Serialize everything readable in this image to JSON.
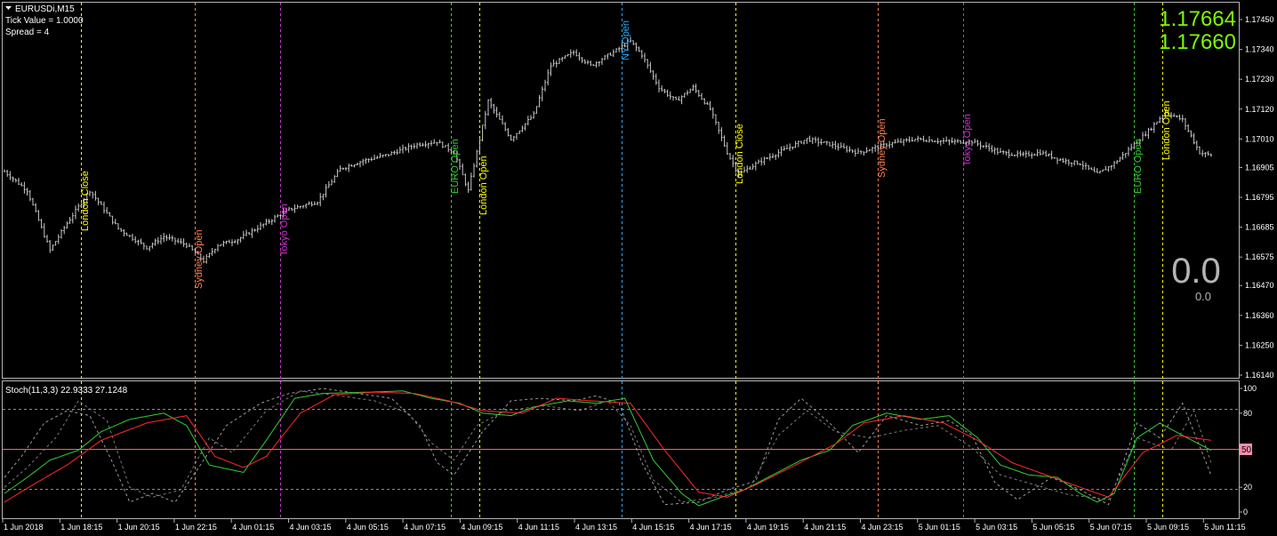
{
  "header": {
    "symbol": "EURUSDi,M15",
    "tick_value": "Tick Value = 1.0000",
    "spread": "Spread = 4"
  },
  "quotes": {
    "ask": "1.17664",
    "bid": "1.17660"
  },
  "counter": {
    "large": "0.0",
    "small": "0.0"
  },
  "colors": {
    "background": "#000000",
    "bars": "#c8c8c8",
    "quotes": "#7CFC00",
    "london": "#ffff00",
    "sydney": "#ff7f50",
    "tokyo": "#cc33cc",
    "euro": "#33cc33",
    "ny": "#2aa8ff",
    "stoch_main": "#32cd32",
    "stoch_signal": "#ff2a2a",
    "level50": "#ff6060"
  },
  "session_lines": [
    {
      "label": "London Close",
      "color": "london"
    },
    {
      "label": "Sydney Open",
      "color": "sydney"
    },
    {
      "label": "Tokyo Open",
      "color": "tokyo"
    },
    {
      "label": "EURO Open",
      "color": "euro"
    },
    {
      "label": "London Open",
      "color": "london"
    },
    {
      "label": "NY Open",
      "color": "ny"
    },
    {
      "label": "London Close",
      "color": "london"
    },
    {
      "label": "Sydney Open",
      "color": "sydney"
    },
    {
      "label": "Tokyo Open",
      "color": "tokyo"
    },
    {
      "label": "EURO Open",
      "color": "euro"
    },
    {
      "label": "London Open",
      "color": "london"
    }
  ],
  "price_axis": [
    "1.17450",
    "1.17340",
    "1.17230",
    "1.17120",
    "1.17010",
    "1.16905",
    "1.16795",
    "1.16685",
    "1.16575",
    "1.16470",
    "1.16360",
    "1.16250",
    "1.16140"
  ],
  "indicator": {
    "title": "Stoch(11,3,3) 22.9333 27.1248",
    "axis": [
      "100",
      "80",
      "20",
      "0"
    ],
    "level_label": "50"
  },
  "time_axis": [
    "1 Jun 2018",
    "1 Jun 18:15",
    "1 Jun 20:15",
    "1 Jun 22:15",
    "4 Jun 01:15",
    "4 Jun 03:15",
    "4 Jun 05:15",
    "4 Jun 07:15",
    "4 Jun 09:15",
    "4 Jun 11:15",
    "4 Jun 13:15",
    "4 Jun 15:15",
    "4 Jun 17:15",
    "4 Jun 19:15",
    "4 Jun 21:15",
    "4 Jun 23:15",
    "5 Jun 01:15",
    "5 Jun 03:15",
    "5 Jun 05:15",
    "5 Jun 07:15",
    "5 Jun 09:15",
    "5 Jun 11:15"
  ],
  "price_anchors": [
    [
      0,
      1.1689
    ],
    [
      8,
      1.1682
    ],
    [
      16,
      1.166
    ],
    [
      22,
      1.167
    ],
    [
      30,
      1.1682
    ],
    [
      40,
      1.1668
    ],
    [
      50,
      1.1661
    ],
    [
      56,
      1.1665
    ],
    [
      64,
      1.1662
    ],
    [
      70,
      1.1656
    ],
    [
      75,
      1.1662
    ],
    [
      82,
      1.1664
    ],
    [
      95,
      1.1672
    ],
    [
      100,
      1.1675
    ],
    [
      110,
      1.1678
    ],
    [
      118,
      1.169
    ],
    [
      126,
      1.1693
    ],
    [
      134,
      1.1695
    ],
    [
      145,
      1.1699
    ],
    [
      152,
      1.17
    ],
    [
      158,
      1.1696
    ],
    [
      163,
      1.1682
    ],
    [
      170,
      1.1715
    ],
    [
      178,
      1.1701
    ],
    [
      186,
      1.171
    ],
    [
      192,
      1.1728
    ],
    [
      200,
      1.1733
    ],
    [
      206,
      1.1728
    ],
    [
      214,
      1.1733
    ],
    [
      220,
      1.1737
    ],
    [
      224,
      1.1732
    ],
    [
      230,
      1.172
    ],
    [
      236,
      1.1715
    ],
    [
      242,
      1.172
    ],
    [
      248,
      1.1712
    ],
    [
      254,
      1.1696
    ],
    [
      258,
      1.1688
    ],
    [
      266,
      1.1693
    ],
    [
      272,
      1.1696
    ],
    [
      282,
      1.1701
    ],
    [
      290,
      1.1699
    ],
    [
      300,
      1.1696
    ],
    [
      310,
      1.1699
    ],
    [
      320,
      1.1701
    ],
    [
      332,
      1.17
    ],
    [
      340,
      1.17
    ],
    [
      350,
      1.1696
    ],
    [
      358,
      1.1695
    ],
    [
      364,
      1.1696
    ],
    [
      372,
      1.1693
    ],
    [
      378,
      1.1692
    ],
    [
      384,
      1.1688
    ],
    [
      390,
      1.1692
    ],
    [
      396,
      1.1698
    ],
    [
      402,
      1.1704
    ],
    [
      408,
      1.1711
    ],
    [
      414,
      1.1708
    ],
    [
      420,
      1.1696
    ],
    [
      424,
      1.1695
    ]
  ],
  "stoch_anchors": {
    "main": [
      [
        0,
        15
      ],
      [
        8,
        28
      ],
      [
        16,
        42
      ],
      [
        26,
        50
      ],
      [
        34,
        65
      ],
      [
        44,
        75
      ],
      [
        56,
        80
      ],
      [
        64,
        70
      ],
      [
        72,
        38
      ],
      [
        84,
        32
      ],
      [
        92,
        58
      ],
      [
        102,
        92
      ],
      [
        112,
        96
      ],
      [
        128,
        97
      ],
      [
        140,
        98
      ],
      [
        150,
        92
      ],
      [
        160,
        88
      ],
      [
        168,
        80
      ],
      [
        178,
        78
      ],
      [
        186,
        85
      ],
      [
        198,
        90
      ],
      [
        208,
        88
      ],
      [
        218,
        92
      ],
      [
        228,
        42
      ],
      [
        238,
        15
      ],
      [
        244,
        5
      ],
      [
        252,
        12
      ],
      [
        260,
        18
      ],
      [
        270,
        30
      ],
      [
        280,
        42
      ],
      [
        290,
        50
      ],
      [
        298,
        70
      ],
      [
        310,
        80
      ],
      [
        322,
        75
      ],
      [
        332,
        78
      ],
      [
        342,
        60
      ],
      [
        350,
        38
      ],
      [
        360,
        30
      ],
      [
        370,
        28
      ],
      [
        378,
        15
      ],
      [
        384,
        8
      ],
      [
        390,
        15
      ],
      [
        398,
        60
      ],
      [
        406,
        72
      ],
      [
        414,
        62
      ],
      [
        424,
        50
      ]
    ],
    "signal": [
      [
        0,
        8
      ],
      [
        10,
        22
      ],
      [
        22,
        38
      ],
      [
        34,
        58
      ],
      [
        50,
        72
      ],
      [
        64,
        78
      ],
      [
        74,
        45
      ],
      [
        84,
        36
      ],
      [
        92,
        45
      ],
      [
        104,
        80
      ],
      [
        116,
        95
      ],
      [
        130,
        97
      ],
      [
        144,
        96
      ],
      [
        156,
        90
      ],
      [
        168,
        82
      ],
      [
        182,
        80
      ],
      [
        194,
        92
      ],
      [
        206,
        90
      ],
      [
        220,
        88
      ],
      [
        232,
        50
      ],
      [
        244,
        16
      ],
      [
        254,
        12
      ],
      [
        264,
        22
      ],
      [
        278,
        38
      ],
      [
        292,
        55
      ],
      [
        302,
        72
      ],
      [
        316,
        78
      ],
      [
        330,
        72
      ],
      [
        342,
        58
      ],
      [
        354,
        40
      ],
      [
        366,
        30
      ],
      [
        378,
        20
      ],
      [
        388,
        12
      ],
      [
        400,
        48
      ],
      [
        412,
        62
      ],
      [
        424,
        58
      ]
    ],
    "dash1": [
      [
        0,
        28
      ],
      [
        6,
        45
      ],
      [
        14,
        72
      ],
      [
        22,
        82
      ],
      [
        30,
        78
      ],
      [
        38,
        40
      ],
      [
        44,
        8
      ],
      [
        52,
        15
      ],
      [
        60,
        8
      ],
      [
        70,
        42
      ],
      [
        78,
        70
      ],
      [
        90,
        88
      ],
      [
        100,
        96
      ],
      [
        112,
        100
      ],
      [
        124,
        96
      ],
      [
        136,
        92
      ],
      [
        146,
        70
      ],
      [
        152,
        40
      ],
      [
        158,
        30
      ],
      [
        168,
        65
      ],
      [
        178,
        90
      ],
      [
        188,
        92
      ],
      [
        200,
        90
      ],
      [
        208,
        94
      ],
      [
        216,
        88
      ],
      [
        224,
        40
      ],
      [
        232,
        6
      ],
      [
        244,
        8
      ],
      [
        254,
        18
      ],
      [
        264,
        25
      ],
      [
        272,
        75
      ],
      [
        280,
        92
      ],
      [
        290,
        72
      ],
      [
        300,
        48
      ],
      [
        310,
        78
      ],
      [
        322,
        70
      ],
      [
        332,
        74
      ],
      [
        340,
        62
      ],
      [
        348,
        24
      ],
      [
        356,
        10
      ],
      [
        368,
        28
      ],
      [
        378,
        18
      ],
      [
        388,
        6
      ],
      [
        398,
        72
      ],
      [
        406,
        60
      ],
      [
        414,
        88
      ],
      [
        424,
        30
      ]
    ],
    "dash2": [
      [
        0,
        20
      ],
      [
        8,
        36
      ],
      [
        18,
        60
      ],
      [
        26,
        90
      ],
      [
        36,
        74
      ],
      [
        44,
        20
      ],
      [
        52,
        12
      ],
      [
        62,
        18
      ],
      [
        72,
        60
      ],
      [
        80,
        48
      ],
      [
        92,
        82
      ],
      [
        104,
        98
      ],
      [
        118,
        94
      ],
      [
        130,
        90
      ],
      [
        142,
        80
      ],
      [
        150,
        56
      ],
      [
        158,
        42
      ],
      [
        166,
        70
      ],
      [
        176,
        82
      ],
      [
        190,
        86
      ],
      [
        202,
        82
      ],
      [
        212,
        90
      ],
      [
        220,
        70
      ],
      [
        228,
        26
      ],
      [
        238,
        8
      ],
      [
        250,
        12
      ],
      [
        262,
        20
      ],
      [
        272,
        62
      ],
      [
        282,
        82
      ],
      [
        292,
        65
      ],
      [
        304,
        60
      ],
      [
        316,
        66
      ],
      [
        328,
        70
      ],
      [
        340,
        52
      ],
      [
        350,
        30
      ],
      [
        362,
        22
      ],
      [
        374,
        14
      ],
      [
        388,
        10
      ],
      [
        398,
        60
      ],
      [
        410,
        50
      ],
      [
        418,
        82
      ],
      [
        424,
        40
      ]
    ]
  }
}
